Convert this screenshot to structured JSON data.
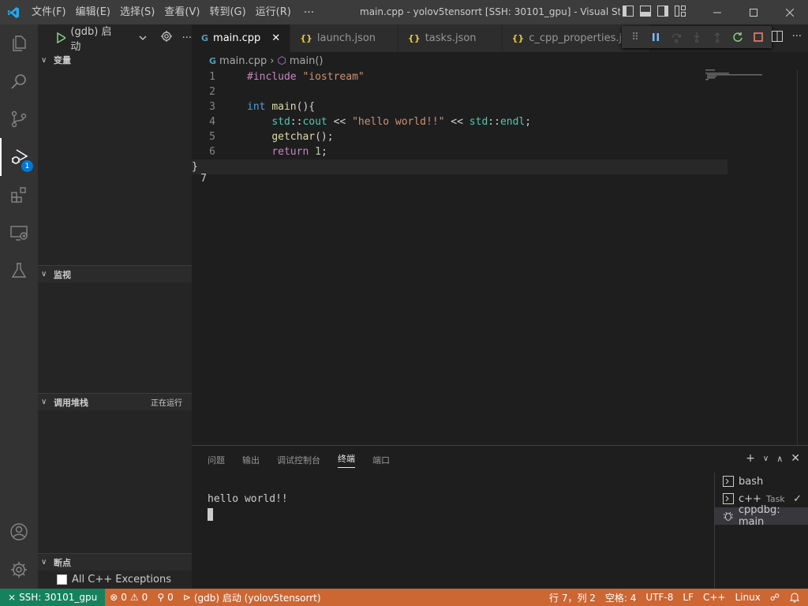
{
  "titlebar": {
    "menus": [
      "文件(F)",
      "编辑(E)",
      "选择(S)",
      "查看(V)",
      "转到(G)",
      "运行(R)"
    ],
    "more": "···",
    "title": "main.cpp - yolov5tensorrt [SSH: 30101_gpu] - Visual Studio ..."
  },
  "activity": {
    "debug_badge": "1"
  },
  "sidebar": {
    "debug_config": "(gdb) 启动",
    "variables_header": "变量",
    "watch_header": "监视",
    "callstack_header": "调用堆栈",
    "callstack_status": "正在运行",
    "breakpoints_header": "断点",
    "breakpoint_item": "All C++ Exceptions"
  },
  "tabs": [
    {
      "label": "main.cpp",
      "icon": "cpp-file-icon"
    },
    {
      "label": "launch.json",
      "icon": "json-file-icon"
    },
    {
      "label": "tasks.json",
      "icon": "json-file-icon"
    },
    {
      "label": "c_cpp_properties.json",
      "icon": "json-file-icon"
    }
  ],
  "breadcrumb": {
    "file": "main.cpp",
    "symbol": "main()"
  },
  "code": {
    "line_numbers": [
      "1",
      "2",
      "3",
      "4",
      "5",
      "6",
      "7"
    ],
    "l1_pp": "#include",
    "l1_str": "\"iostream\"",
    "l3_kw": "int",
    "l3_fn": "main",
    "l3_rest": "(){",
    "l4_ns1": "std",
    "l4_sep1": "::",
    "l4_fn1": "cout",
    "l4_op1": " << ",
    "l4_str": "\"hello world!!\"",
    "l4_op2": " << ",
    "l4_ns2": "std",
    "l4_sep2": "::",
    "l4_fn2": "endl",
    "l4_end": ";",
    "l5_fn": "getchar",
    "l5_rest": "();",
    "l6_kw": "return",
    "l6_num": "1",
    "l6_end": ";",
    "l7": "}"
  },
  "panel": {
    "tabs": [
      "问题",
      "输出",
      "调试控制台",
      "终端",
      "端口"
    ],
    "active_tab": "终端",
    "terminal_output": "hello world!!",
    "terminals": [
      {
        "label": "bash",
        "suffix": ""
      },
      {
        "label": "c++",
        "suffix": "Task"
      },
      {
        "label": "cppdbg: main",
        "suffix": ""
      }
    ]
  },
  "status": {
    "remote": "SSH: 30101_gpu",
    "errors": "0",
    "warnings": "0",
    "ports": "0",
    "debug": "(gdb) 启动 (yolov5tensorrt)",
    "position": "行 7，列 2",
    "indent": "空格: 4",
    "encoding": "UTF-8",
    "eol": "LF",
    "language": "C++",
    "os": "Linux"
  },
  "colors": {
    "statusbar": "#cc6633",
    "remote": "#16825d",
    "badge": "#0078d4"
  }
}
